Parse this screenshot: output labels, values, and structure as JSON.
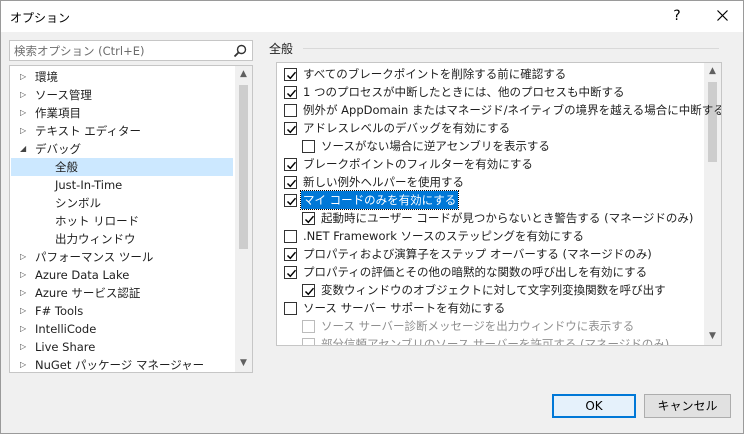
{
  "window": {
    "title": "オプション",
    "help_label": "?"
  },
  "search": {
    "placeholder": "検索オプション (Ctrl+E)"
  },
  "tree": {
    "items": [
      {
        "label": "環境",
        "expanded": false,
        "level": 0
      },
      {
        "label": "ソース管理",
        "expanded": false,
        "level": 0
      },
      {
        "label": "作業項目",
        "expanded": false,
        "level": 0
      },
      {
        "label": "テキスト エディター",
        "expanded": false,
        "level": 0
      },
      {
        "label": "デバッグ",
        "expanded": true,
        "level": 0
      },
      {
        "label": "全般",
        "level": 1,
        "selected": true
      },
      {
        "label": "Just-In-Time",
        "level": 1
      },
      {
        "label": "シンボル",
        "level": 1
      },
      {
        "label": "ホット リロード",
        "level": 1
      },
      {
        "label": "出力ウィンドウ",
        "level": 1
      },
      {
        "label": "パフォーマンス ツール",
        "expanded": false,
        "level": 0
      },
      {
        "label": "Azure Data Lake",
        "expanded": false,
        "level": 0
      },
      {
        "label": "Azure サービス認証",
        "expanded": false,
        "level": 0
      },
      {
        "label": "F# Tools",
        "expanded": false,
        "level": 0
      },
      {
        "label": "IntelliCode",
        "expanded": false,
        "level": 0
      },
      {
        "label": "Live Share",
        "expanded": false,
        "level": 0
      },
      {
        "label": "NuGet パッケージ マネージャー",
        "expanded": false,
        "level": 0
      }
    ]
  },
  "section": {
    "title": "全般"
  },
  "options": [
    {
      "label": "すべてのブレークポイントを削除する前に確認する",
      "checked": true,
      "indent": 0
    },
    {
      "label": "1 つのプロセスが中断したときには、他のプロセスも中断する",
      "checked": true,
      "indent": 0
    },
    {
      "label": "例外が AppDomain またはマネージド/ネイティブの境界を越える場合に中断する (マネー",
      "checked": false,
      "indent": 0
    },
    {
      "label": "アドレスレベルのデバッグを有効にする",
      "checked": true,
      "indent": 0
    },
    {
      "label": "ソースがない場合に逆アセンブリを表示する",
      "checked": false,
      "indent": 1
    },
    {
      "label": "ブレークポイントのフィルターを有効にする",
      "checked": true,
      "indent": 0
    },
    {
      "label": "新しい例外ヘルパーを使用する",
      "checked": true,
      "indent": 0
    },
    {
      "label": "マイ コードのみを有効にする",
      "checked": true,
      "indent": 0,
      "focused": true
    },
    {
      "label": "起動時にユーザー コードが見つからないとき警告する (マネージドのみ)",
      "checked": true,
      "indent": 1
    },
    {
      "label": ".NET Framework ソースのステッピングを有効にする",
      "checked": false,
      "indent": 0
    },
    {
      "label": "プロパティおよび演算子をステップ オーバーする (マネージドのみ)",
      "checked": true,
      "indent": 0
    },
    {
      "label": "プロパティの評価とその他の暗黙的な関数の呼び出しを有効にする",
      "checked": true,
      "indent": 0
    },
    {
      "label": "変数ウィンドウのオブジェクトに対して文字列変換関数を呼び出す",
      "checked": true,
      "indent": 1
    },
    {
      "label": "ソース サーバー サポートを有効にする",
      "checked": false,
      "indent": 0
    },
    {
      "label": "ソース サーバー診断メッセージを出力ウィンドウに表示する",
      "checked": false,
      "indent": 1,
      "disabled": true
    },
    {
      "label": "部分信頼アセンブリのソース サーバーを許可する (マネージドのみ)",
      "checked": false,
      "indent": 1,
      "disabled": true
    }
  ],
  "buttons": {
    "ok": "OK",
    "cancel": "キャンセル"
  },
  "icons": {
    "search": "search-icon",
    "close": "close-icon",
    "expand": "chevron-right-icon",
    "collapse": "chevron-down-icon",
    "check": "checkmark-icon"
  },
  "colors": {
    "accent": "#0078d7",
    "selection": "#cce8ff"
  }
}
